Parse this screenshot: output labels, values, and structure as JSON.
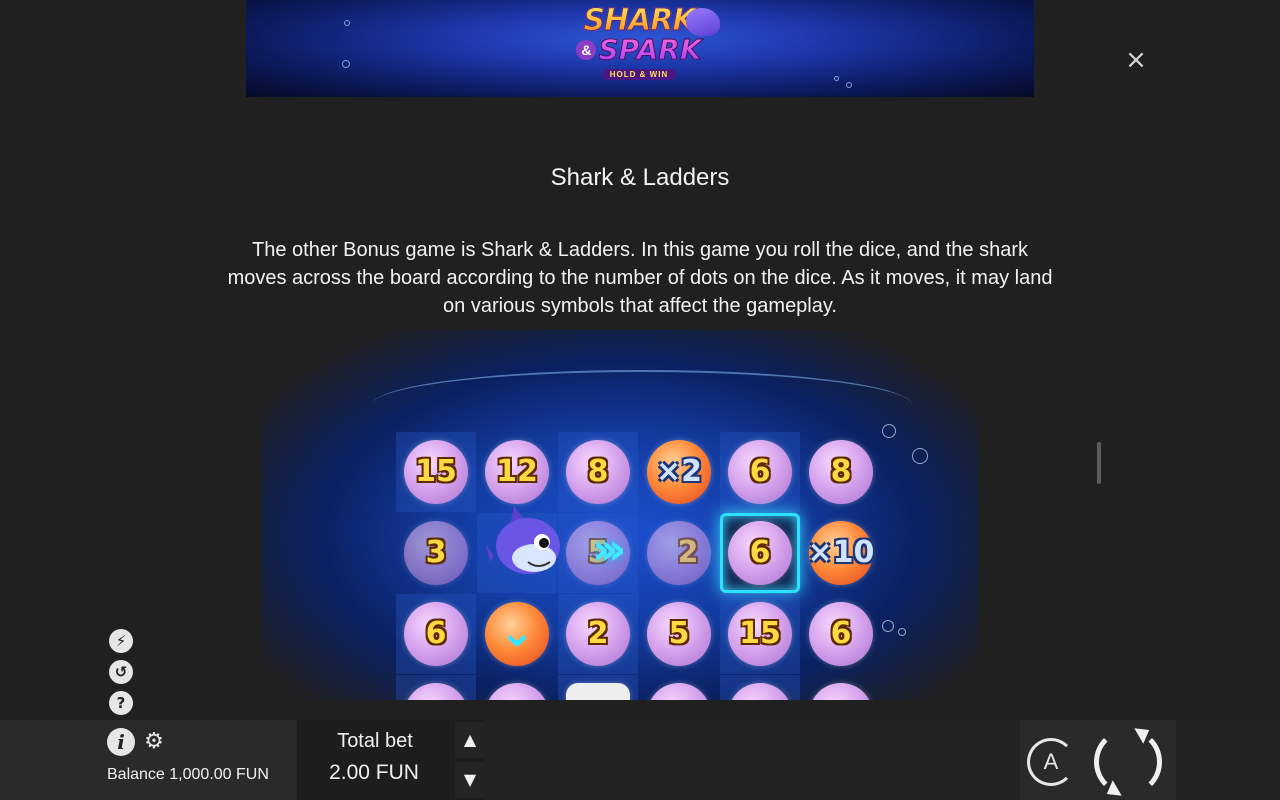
{
  "banner": {
    "logo_line1": "SHARK",
    "logo_amp": "&",
    "logo_line2": "SPARK",
    "logo_tagline": "HOLD & WIN"
  },
  "close_label": "×",
  "content": {
    "title": "Shark & Ladders",
    "description": "The other Bonus game is Shark & Ladders. In this game you roll the dice, and the shark moves across the board according to the number of dots on the dice. As it moves, it may land on various symbols that affect the gameplay."
  },
  "board": {
    "row1": [
      "15",
      "12",
      "8",
      "×2",
      "6",
      "8"
    ],
    "row2": [
      "3",
      "",
      "5",
      "2",
      "6",
      "×10"
    ],
    "row3": [
      "6",
      "",
      "2",
      "5",
      "15",
      "6"
    ]
  },
  "side_icons": {
    "turbo": "⚡",
    "history": "↺",
    "help": "?"
  },
  "bottom_bar": {
    "info": "i",
    "settings": "⚙",
    "balance_label": "Balance",
    "balance_value": "1,000.00 FUN",
    "total_bet_label": "Total bet",
    "total_bet_value": "2.00 FUN",
    "bet_up": "▲",
    "bet_down": "▼",
    "auto_label": "A"
  },
  "colors": {
    "background": "#202020",
    "highlight": "#2ee0ff",
    "number_gold": "#ffd942"
  }
}
